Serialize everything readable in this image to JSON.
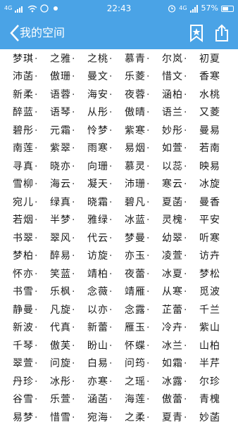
{
  "status": {
    "carrier_left": "4G",
    "time": "22:43",
    "carrier_right": "4G",
    "battery_percent": "57%",
    "battery_level": 0.57
  },
  "header": {
    "title": "我的空间",
    "icons": [
      "back-arrow-icon",
      "bookmark-star-icon",
      "share-icon"
    ],
    "accent_color": "#4aa3e6"
  },
  "names": [
    [
      "梦琪",
      "之雅",
      "之桃",
      "慕青",
      "尔岚",
      "初夏"
    ],
    [
      "沛菡",
      "傲珊",
      "曼文",
      "乐菱",
      "惜文",
      "香寒"
    ],
    [
      "新柔",
      "语蓉",
      "海安",
      "夜蓉",
      "涵柏",
      "水桃"
    ],
    [
      "醉蓝",
      "语琴",
      "从彤",
      "傲晴",
      "语兰",
      "又菱"
    ],
    [
      "碧彤",
      "元霜",
      "怜梦",
      "紫寒",
      "妙彤",
      "曼易"
    ],
    [
      "南莲",
      "紫翠",
      "雨寒",
      "易烟",
      "如萱",
      "若南"
    ],
    [
      "寻真",
      "晓亦",
      "向珊",
      "慕灵",
      "以蕊",
      "映易"
    ],
    [
      "雪柳",
      "海云",
      "凝天",
      "沛珊",
      "寒云",
      "冰旋"
    ],
    [
      "宛儿",
      "绿真",
      "晓霜",
      "碧凡",
      "夏菡",
      "曼香"
    ],
    [
      "若烟",
      "半梦",
      "雅绿",
      "冰蓝",
      "灵槐",
      "平安"
    ],
    [
      "书翠",
      "翠风",
      "代云",
      "梦曼",
      "幼翠",
      "听寒"
    ],
    [
      "梦柏",
      "醉易",
      "访旋",
      "亦玉",
      "凌萱",
      "访卉"
    ],
    [
      "怀亦",
      "笑蓝",
      "靖柏",
      "夜蕾",
      "冰夏",
      "梦松"
    ],
    [
      "书雪",
      "乐枫",
      "念薇",
      "靖雁",
      "从寒",
      "觅波"
    ],
    [
      "静曼",
      "凡旋",
      "以亦",
      "念露",
      "芷蕾",
      "千兰"
    ],
    [
      "新波",
      "代真",
      "新蕾",
      "雁玉",
      "冷卉",
      "紫山"
    ],
    [
      "千琴",
      "傲芙",
      "盼山",
      "怀蝶",
      "冰兰",
      "山柏"
    ],
    [
      "翠萱",
      "问旋",
      "白易",
      "问筠",
      "如霜",
      "半芹"
    ],
    [
      "丹珍",
      "冰彤",
      "亦寒",
      "之瑶",
      "冰露",
      "尔珍"
    ],
    [
      "谷雪",
      "乐萱",
      "涵菡",
      "海莲",
      "傲蕾",
      "青槐"
    ],
    [
      "易梦",
      "惜雪",
      "宛海",
      "之柔",
      "夏青",
      "妙菡"
    ]
  ]
}
